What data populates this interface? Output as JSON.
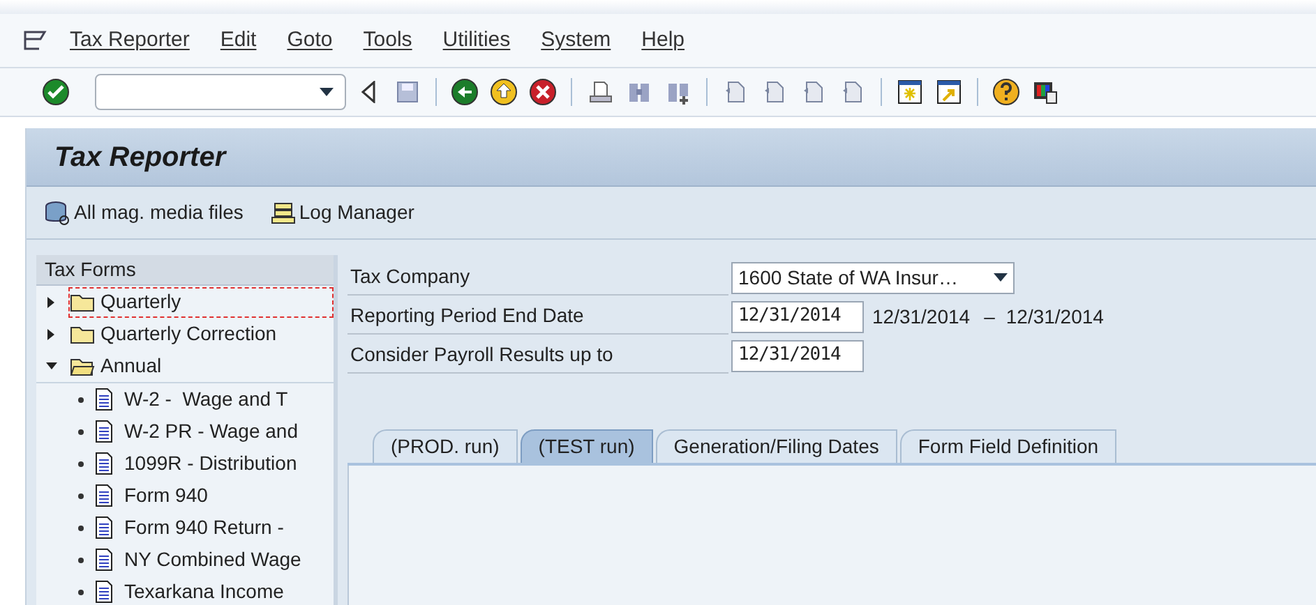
{
  "menu": [
    "Tax Reporter",
    "Edit",
    "Goto",
    "Tools",
    "Utilities",
    "System",
    "Help"
  ],
  "title": "Tax Reporter",
  "app_toolbar": [
    {
      "kind": "media",
      "label": "All mag. media files"
    },
    {
      "kind": "log",
      "label": "Log Manager"
    }
  ],
  "tree": {
    "header": "Tax Forms",
    "items": [
      {
        "label": "Quarterly",
        "expanded": false,
        "selected": true
      },
      {
        "label": "Quarterly Correction",
        "expanded": false,
        "selected": false
      },
      {
        "label": "Annual",
        "expanded": true,
        "selected": false,
        "children": [
          {
            "label": "W-2 -  Wage and T"
          },
          {
            "label": "W-2 PR - Wage and"
          },
          {
            "label": "1099R - Distribution"
          },
          {
            "label": "Form 940"
          },
          {
            "label": "Form 940 Return -"
          },
          {
            "label": "NY Combined Wage"
          },
          {
            "label": "Texarkana Income"
          }
        ]
      }
    ]
  },
  "form": [
    {
      "label": "Tax Company",
      "kind": "dropdown",
      "value": "1600 State of WA Insur…"
    },
    {
      "label": "Reporting Period End Date",
      "kind": "date",
      "value": "12/31/2014",
      "range_from": "12/31/2014",
      "range_sep": "–",
      "range_to": "12/31/2014"
    },
    {
      "label": "Consider Payroll Results up to",
      "kind": "date",
      "value": "12/31/2014"
    }
  ],
  "tabs": [
    {
      "label": "(PROD. run)",
      "selected": false
    },
    {
      "label": "(TEST run)",
      "selected": true
    },
    {
      "label": "Generation/Filing Dates",
      "selected": false
    },
    {
      "label": "Form Field Definition",
      "selected": false
    }
  ]
}
